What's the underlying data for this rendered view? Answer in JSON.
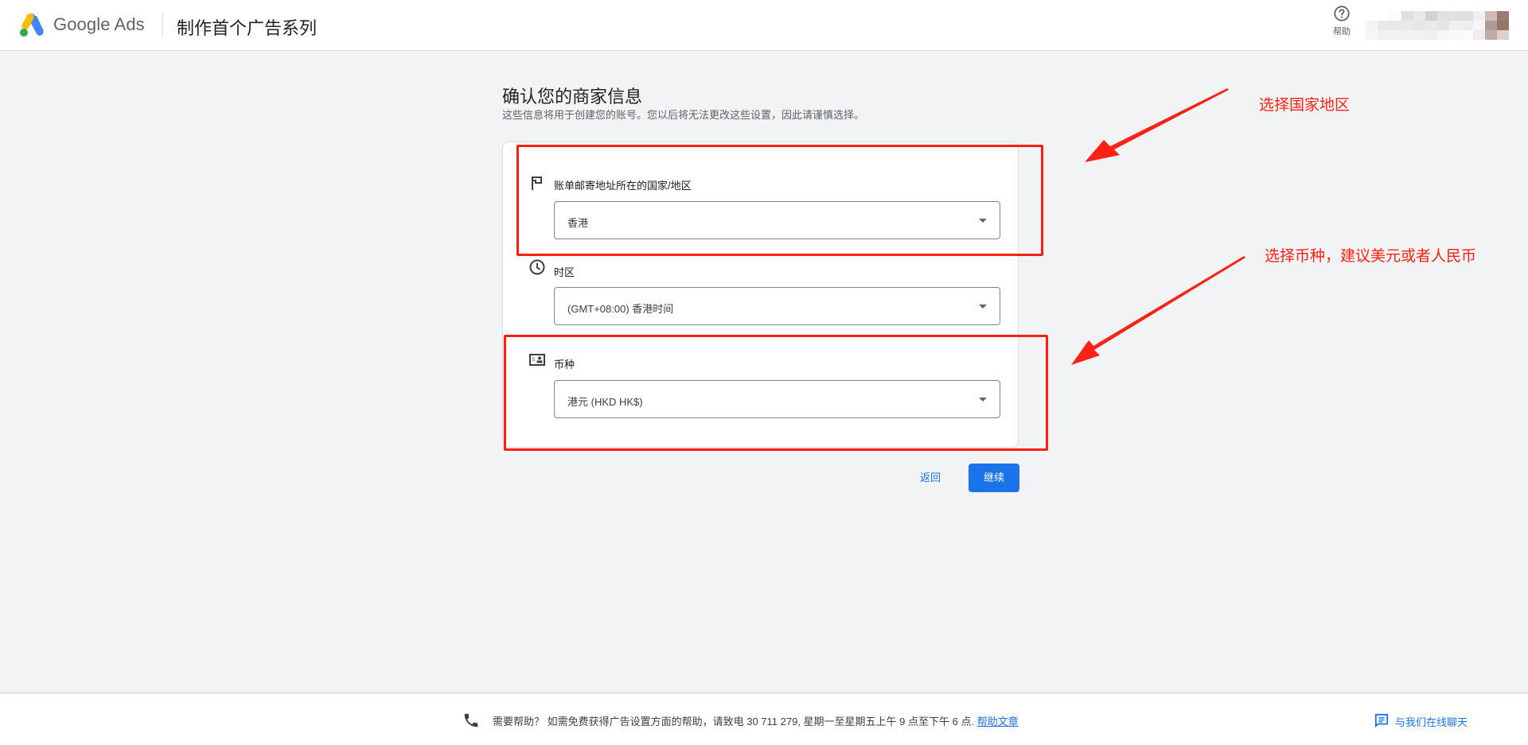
{
  "header": {
    "brand": "Google Ads",
    "title": "制作首个广告系列",
    "help_label": "帮助",
    "logo_colors": {
      "blue": "#4285f4",
      "yellow": "#fbbc04",
      "green": "#34a853"
    }
  },
  "page": {
    "heading": "确认您的商家信息",
    "subtitle": "这些信息将用于创建您的账号。您以后将无法更改这些设置，因此请谨慎选择。"
  },
  "form": {
    "country": {
      "icon": "flag-icon",
      "label": "账单邮寄地址所在的国家/地区",
      "value": "香港"
    },
    "timezone": {
      "icon": "clock-icon",
      "label": "时区",
      "value": "(GMT+08:00) 香港时间"
    },
    "currency": {
      "icon": "currency-icon",
      "label": "币种",
      "value": "港元 (HKD HK$)"
    }
  },
  "actions": {
    "back_label": "返回",
    "continue_label": "继续",
    "primary_color": "#1a73e8"
  },
  "annotations": {
    "color": "#ff2114",
    "country_note": "选择国家地区",
    "currency_note": "选择币种，建议美元或者人民币"
  },
  "footer": {
    "help_text": "需要帮助？ 如需免费获得广告设置方面的帮助，请致电 30 711 279, 星期一至星期五上午 9 点至下午 6 点. ",
    "help_link": "帮助文章",
    "chat_label": "与我们在线聊天"
  }
}
